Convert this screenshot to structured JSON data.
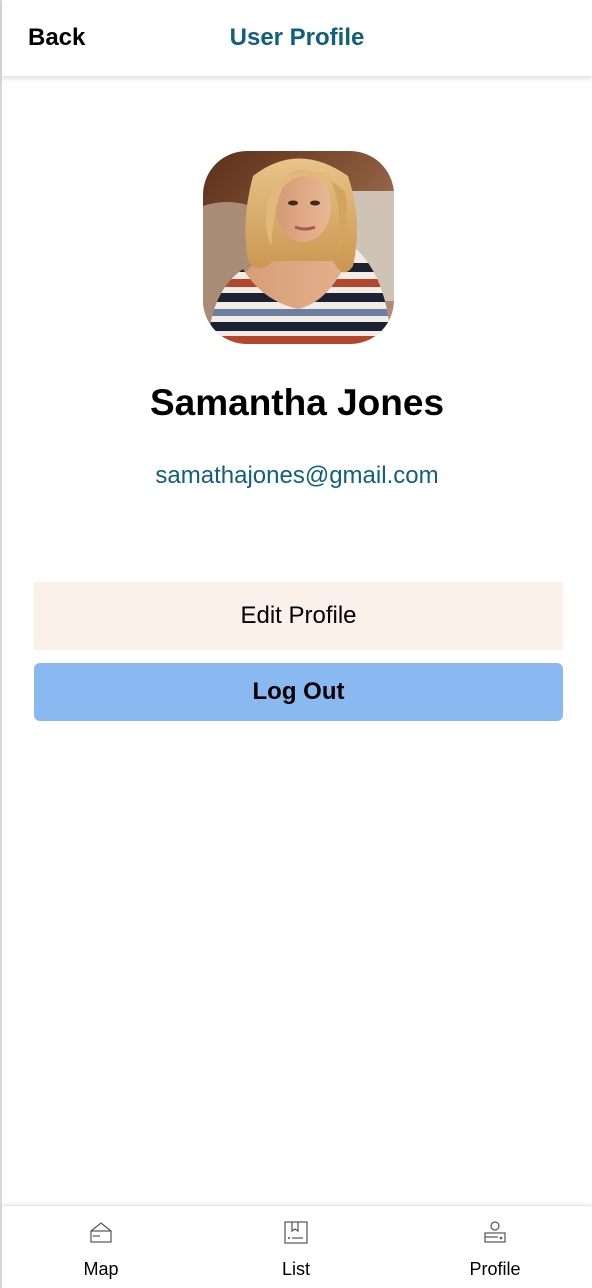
{
  "header": {
    "back_label": "Back",
    "title": "User Profile"
  },
  "profile": {
    "name": "Samantha Jones",
    "email": "samathajones@gmail.com"
  },
  "actions": {
    "edit_label": "Edit Profile",
    "logout_label": "Log Out"
  },
  "tabs": [
    {
      "label": "Map",
      "icon": "map-icon"
    },
    {
      "label": "List",
      "icon": "list-icon"
    },
    {
      "label": "Profile",
      "icon": "profile-icon"
    }
  ],
  "colors": {
    "accent": "#0f5f7d",
    "edit_button_bg": "#fcf0ea",
    "logout_button_bg": "#8ab8f0"
  }
}
